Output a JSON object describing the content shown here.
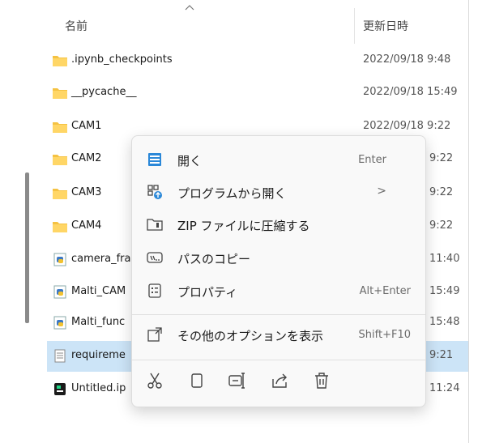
{
  "header": {
    "name_label": "名前",
    "date_label": "更新日時"
  },
  "files": [
    {
      "name": ".ipynb_checkpoints",
      "date": "2022/09/18 9:48",
      "type": "folder"
    },
    {
      "name": "__pycache__",
      "date": "2022/09/18 15:49",
      "type": "folder"
    },
    {
      "name": "CAM1",
      "date": "2022/09/18 9:22",
      "type": "folder"
    },
    {
      "name": "CAM2",
      "date": "9:22",
      "type": "folder"
    },
    {
      "name": "CAM3",
      "date": "9:22",
      "type": "folder"
    },
    {
      "name": "CAM4",
      "date": "9:22",
      "type": "folder"
    },
    {
      "name": "camera_fra",
      "date": "11:40",
      "type": "python"
    },
    {
      "name": "Malti_CAM",
      "date": "15:49",
      "type": "python"
    },
    {
      "name": "Malti_func",
      "date": "15:48",
      "type": "python"
    },
    {
      "name": "requireme",
      "date": "9:21",
      "type": "text",
      "selected": true
    },
    {
      "name": "Untitled.ip",
      "date": "11:24",
      "type": "notebook"
    }
  ],
  "context_menu": {
    "items": [
      {
        "label": "開く",
        "shortcut": "Enter",
        "icon": "open-icon"
      },
      {
        "label": "プログラムから開く",
        "shortcut": ">",
        "icon": "open-with-icon"
      },
      {
        "label": "ZIP ファイルに圧縮する",
        "shortcut": "",
        "icon": "zip-icon"
      },
      {
        "label": "パスのコピー",
        "shortcut": "",
        "icon": "copy-path-icon"
      },
      {
        "label": "プロパティ",
        "shortcut": "Alt+Enter",
        "icon": "properties-icon"
      },
      {
        "label": "その他のオプションを表示",
        "shortcut": "Shift+F10",
        "icon": "more-options-icon"
      }
    ],
    "quick_actions": [
      "cut-icon",
      "copy-icon",
      "rename-icon",
      "share-icon",
      "delete-icon"
    ]
  },
  "colors": {
    "folder": "#f5c242",
    "selected_row": "#cce4f7",
    "accent": "#0067c0"
  }
}
